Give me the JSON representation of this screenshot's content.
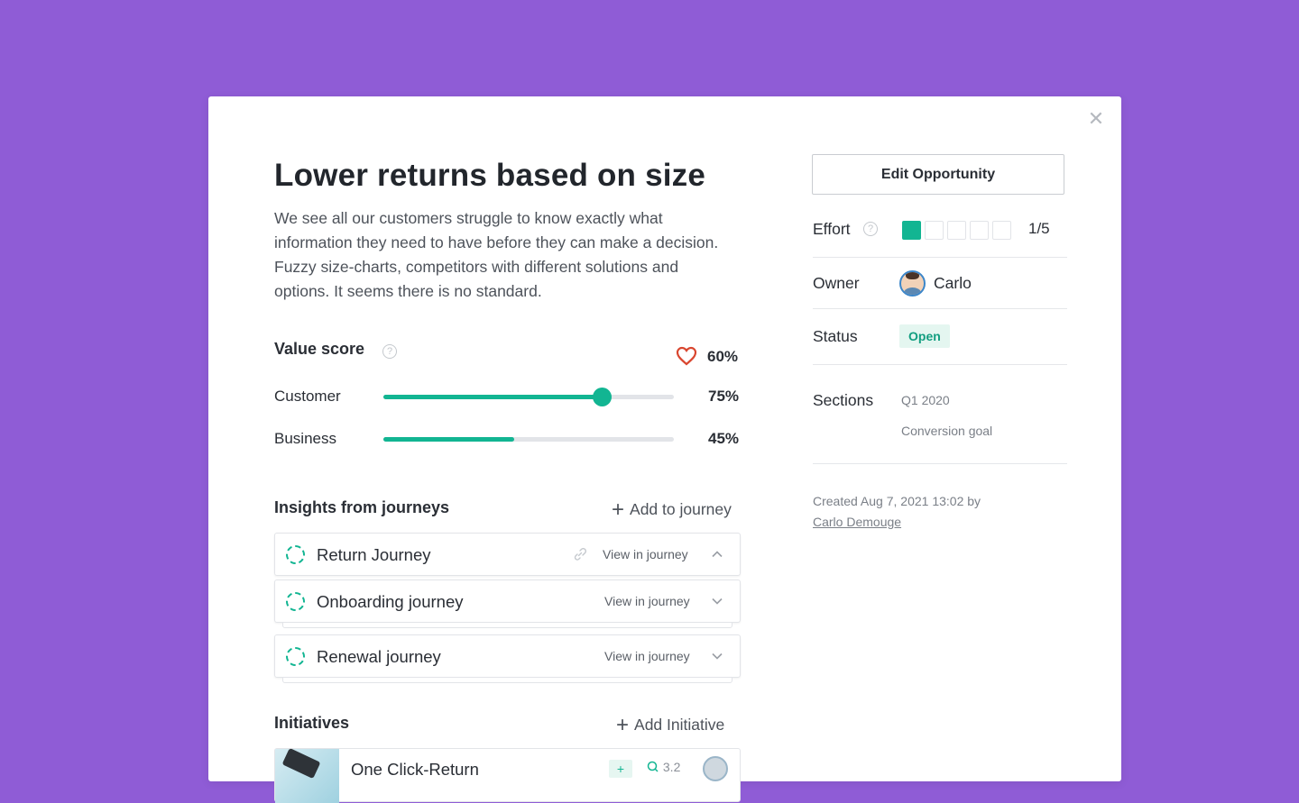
{
  "opportunity": {
    "title": "Lower returns based on size",
    "description": "We see all our customers struggle to know exactly what information they need to have before they can make a decision. Fuzzy size-charts, competitors with different solutions and options. It seems there is no standard."
  },
  "value_score": {
    "label": "Value score",
    "total": "60%",
    "customer": {
      "label": "Customer",
      "value": "75%",
      "fraction": 0.75
    },
    "business": {
      "label": "Business",
      "value": "45%",
      "fraction": 0.45
    }
  },
  "insights": {
    "heading": "Insights from journeys",
    "add_label": "Add to journey",
    "journeys": [
      {
        "name": "Return Journey",
        "view": "View in journey",
        "expanded": true
      },
      {
        "name": "Onboarding journey",
        "view": "View in journey",
        "expanded": false
      },
      {
        "name": "Renewal journey",
        "view": "View in journey",
        "expanded": false
      }
    ]
  },
  "initiatives": {
    "heading": "Initiatives",
    "add_label": "Add Initiative",
    "items": [
      {
        "name": "One Click-Return",
        "score": "3.2"
      }
    ]
  },
  "sidebar": {
    "edit_button": "Edit Opportunity",
    "effort": {
      "label": "Effort",
      "value": "1/5",
      "level": 1,
      "max": 5
    },
    "owner": {
      "label": "Owner",
      "name": "Carlo"
    },
    "status": {
      "label": "Status",
      "value": "Open"
    },
    "sections": {
      "label": "Sections",
      "items": [
        "Q1 2020",
        "Conversion goal"
      ]
    },
    "created_text": "Created Aug 7, 2021 13:02 by",
    "created_by": "Carlo Demouge"
  },
  "colors": {
    "background": "#8f5cd6",
    "accent": "#12b592",
    "heart": "#d9462f"
  }
}
